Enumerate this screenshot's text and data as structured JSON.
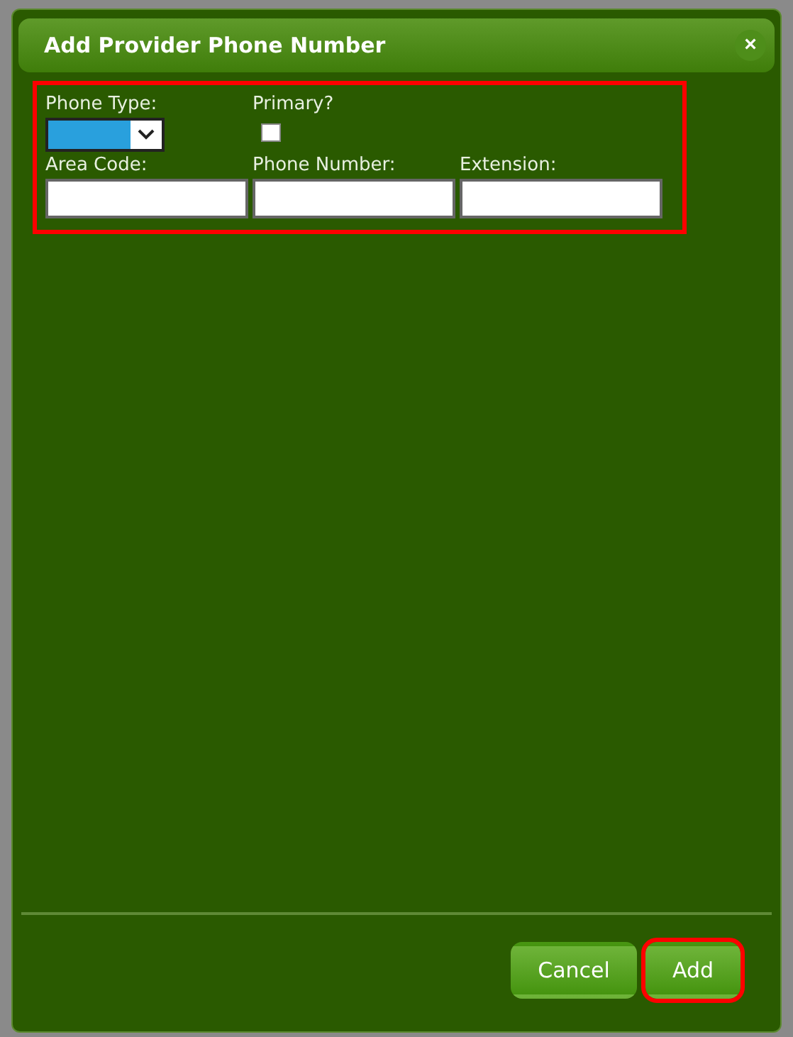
{
  "window": {
    "title": "Add Provider Phone Number",
    "close": "×"
  },
  "form": {
    "highlighted": true,
    "phone_type": {
      "label": "Phone Type:"
    },
    "primary": {
      "label": "Primary?",
      "checked": false
    },
    "fields": [
      {
        "label": "Area Code:"
      },
      {
        "label": "Phone Number:"
      },
      {
        "label": "Extension:"
      }
    ]
  },
  "buttons": [
    {
      "label": "Cancel",
      "highlighted": false
    },
    {
      "label": "Add",
      "highlighted": true
    }
  ]
}
